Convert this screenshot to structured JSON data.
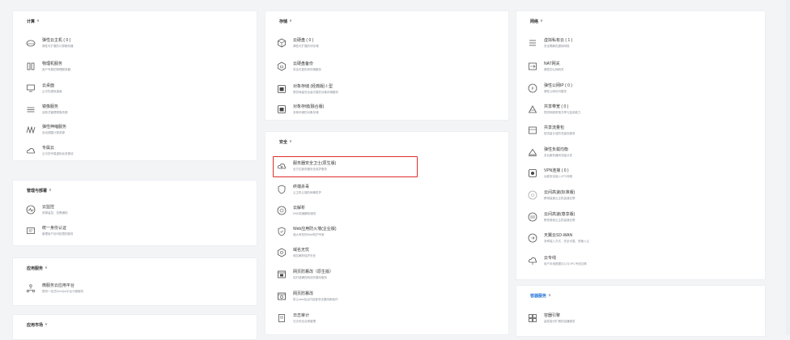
{
  "sections": {
    "compute": {
      "title": "计算",
      "items": [
        {
          "name": "弹性云主机 ( 0 )",
          "desc": "弹性可扩展的计算服务器",
          "icon": "cloud-server-icon"
        },
        {
          "name": "物理机服务",
          "desc": "用户专属的物理服务器",
          "icon": "physical-machine-icon"
        },
        {
          "name": "云桌面",
          "desc": "云中的虚拟桌面",
          "icon": "cloud-desktop-icon"
        },
        {
          "name": "镜像服务",
          "desc": "自助式管理镜像资源",
          "icon": "image-service-icon"
        },
        {
          "name": "弹性伸缩服务",
          "desc": "自动调整计算资源",
          "icon": "auto-scaling-icon"
        },
        {
          "name": "专属云",
          "desc": "云中的专属虚拟化资源池",
          "icon": "dedicated-cloud-icon"
        }
      ]
    },
    "management": {
      "title": "管理与部署",
      "items": [
        {
          "name": "云监控",
          "desc": "资源监控、告警通知",
          "icon": "cloud-monitor-icon"
        },
        {
          "name": "统一身份认证",
          "desc": "管理用户访问权限的服务",
          "icon": "identity-auth-icon"
        }
      ]
    },
    "app_service": {
      "title": "应用服务",
      "items": [
        {
          "name": "微服务云应用平台",
          "desc": "提供一站式DevOps平台与微服务",
          "icon": "microservice-icon"
        }
      ]
    },
    "app_market": {
      "title": "应用市场"
    },
    "storage": {
      "title": "存储",
      "items": [
        {
          "name": "云硬盘 ( 0 )",
          "desc": "弹性可扩展的块存储",
          "icon": "cloud-disk-icon"
        },
        {
          "name": "云硬盘备份",
          "desc": "安全可靠的块存储服务",
          "icon": "disk-backup-icon"
        },
        {
          "name": "对象存储 (经典版) Ⅰ 型",
          "desc": "提供海量安全高可靠的对象存储服务",
          "icon": "object-storage-icon"
        },
        {
          "name": "对象存储(融合版)",
          "desc": "多种存储的对象存储",
          "icon": "object-storage-fusion-icon"
        }
      ]
    },
    "security": {
      "title": "安全",
      "items": [
        {
          "name": "服务器安全卫士(原生版)",
          "desc": "全方位服务器安全保护服务",
          "icon": "server-guard-icon"
        },
        {
          "name": "终端杀毒",
          "desc": "云主机云端的病毒防护",
          "icon": "antivirus-icon"
        },
        {
          "name": "云解析",
          "desc": "DNS权威解析服务",
          "icon": "cloud-dns-icon"
        },
        {
          "name": "Web应用防火墙(企业版)",
          "desc": "强大有效的Web防护专家",
          "icon": "waf-icon"
        },
        {
          "name": "域名无忧",
          "desc": "域名解析保护无忧",
          "icon": "domain-worry-free-icon"
        },
        {
          "name": "网页防篡改（原生版）",
          "desc": "实时准确的网页防篡改服务",
          "icon": "anti-tamper-icon"
        },
        {
          "name": "网页防篡改",
          "desc": "防止web站点内容被非法篡改和破坏",
          "icon": "web-tamper-icon"
        },
        {
          "name": "日志审计",
          "desc": "日志安全合规管理",
          "icon": "log-audit-icon"
        }
      ]
    },
    "network": {
      "title": "网络",
      "items": [
        {
          "name": "虚拟私有云 ( 1 )",
          "desc": "安全隔离的虚拟网络",
          "icon": "vpc-icon"
        },
        {
          "name": "NAT网关",
          "desc": "弹性的公网网关",
          "icon": "nat-gateway-icon"
        },
        {
          "name": "弹性公网IP ( 0 )",
          "desc": "弹性公网访问服务",
          "icon": "elastic-ip-icon"
        },
        {
          "name": "共享带宽 ( 0 )",
          "desc": "提供网络带宽共享与复用能力",
          "icon": "shared-bandwidth-icon"
        },
        {
          "name": "共享流量包",
          "desc": "按流量计费的流量包服务",
          "icon": "shared-traffic-icon"
        },
        {
          "name": "弹性负载均衡",
          "desc": "多台服务器间流量分发",
          "icon": "load-balancer-icon"
        },
        {
          "name": "VPN连接 ( 0 )",
          "desc": "远程安全接入VPC网络",
          "icon": "vpn-icon"
        },
        {
          "name": "云间高速(标准版)",
          "desc": "跨域高速云主机高速互联",
          "icon": "cloud-express-std-icon"
        },
        {
          "name": "云间高速(尊享版)",
          "desc": "跨资源池云主机高速互联",
          "icon": "cloud-express-premium-icon"
        },
        {
          "name": "天翼云SD-WAN",
          "desc": "多种接入方式、安全可靠、快速入云",
          "icon": "sdwan-icon"
        },
        {
          "name": "云专线",
          "desc": "用户本地数据中心与VPC专线互联",
          "icon": "direct-connect-icon"
        }
      ]
    },
    "container": {
      "title": "容器服务",
      "items": [
        {
          "name": "容器引擎",
          "desc": "高性能可扩展的容器服务",
          "icon": "container-engine-icon"
        }
      ]
    }
  },
  "colors": {
    "accent": "#1d6fd8",
    "highlight": "#e02d2d",
    "text": "#333333",
    "desc": "#8a8f98"
  }
}
